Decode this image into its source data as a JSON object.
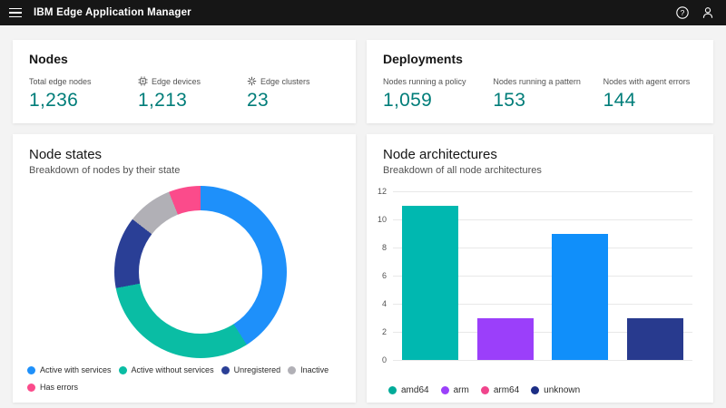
{
  "header": {
    "title": "IBM Edge Application Manager",
    "menu_icon": "hamburger-menu-icon",
    "help_icon": "help-icon",
    "user_icon": "user-avatar-icon"
  },
  "colors": {
    "header_bg": "#161616",
    "page_bg": "#f3f3f3",
    "card_bg": "#ffffff",
    "metric_value": "#007d79",
    "grid_line": "#e8e8e8"
  },
  "nodes_card": {
    "title": "Nodes",
    "metrics": [
      {
        "label": "Total edge nodes",
        "value": "1,236",
        "icon": "none"
      },
      {
        "label": "Edge devices",
        "value": "1,213",
        "icon": "chip-icon"
      },
      {
        "label": "Edge clusters",
        "value": "23",
        "icon": "cluster-icon"
      }
    ]
  },
  "deployments_card": {
    "title": "Deployments",
    "metrics": [
      {
        "label": "Nodes running a policy",
        "value": "1,059"
      },
      {
        "label": "Nodes running a pattern",
        "value": "153"
      },
      {
        "label": "Nodes with agent errors",
        "value": "144"
      }
    ]
  },
  "chart_data": [
    {
      "type": "pie",
      "donut": true,
      "title": "Node states",
      "subtitle": "Breakdown of nodes by their state",
      "legend_position": "bottom",
      "segments": [
        {
          "label": "Active with services",
          "percent": 41,
          "color": "#1e90fa"
        },
        {
          "label": "Active without services",
          "percent": 31,
          "color": "#0abda4"
        },
        {
          "label": "Unregistered",
          "percent": 13.5,
          "color": "#2a3f96"
        },
        {
          "label": "Inactive",
          "percent": 8.5,
          "color": "#b1b0b6"
        },
        {
          "label": "Has errors",
          "percent": 6,
          "color": "#fb4b8b"
        }
      ]
    },
    {
      "type": "bar",
      "title": "Node architectures",
      "subtitle": "Breakdown of all node architectures",
      "categories": [
        "amd64",
        "arm",
        "arm64",
        "unknown"
      ],
      "values": [
        11,
        3,
        9,
        3
      ],
      "bar_colors": [
        "#00b8b0",
        "#9b3ffa",
        "#108ffa",
        "#283a8e"
      ],
      "legend_colors": [
        "#00ab99",
        "#9b40fa",
        "#f0458c",
        "#1c2e85"
      ],
      "xlabel": "",
      "ylabel": "",
      "ylim": [
        0,
        12
      ],
      "yticks": [
        0,
        2,
        4,
        6,
        8,
        10,
        12
      ],
      "grid": true,
      "legend_position": "bottom"
    }
  ]
}
